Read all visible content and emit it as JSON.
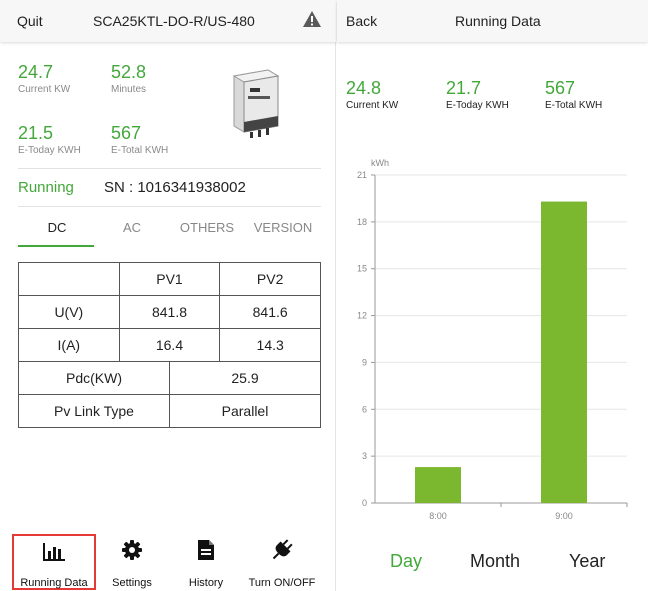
{
  "left": {
    "header": {
      "quit_label": "Quit",
      "model": "SCA25KTL-DO-R/US-480",
      "warning_icon": "warning-icon"
    },
    "stats": [
      {
        "value": "24.7",
        "label": "Current KW"
      },
      {
        "value": "52.8",
        "label": "Minutes"
      },
      {
        "value": "21.5",
        "label": "E-Today KWH"
      },
      {
        "value": "567",
        "label": "E-Total KWH"
      }
    ],
    "status": "Running",
    "sn": "SN : 1016341938002",
    "tabs": [
      "DC",
      "AC",
      "OTHERS",
      "VERSION"
    ],
    "active_tab": "DC",
    "table": {
      "head": [
        "",
        "PV1",
        "PV2"
      ],
      "rows": [
        [
          "U(V)",
          "841.8",
          "841.6"
        ],
        [
          "I(A)",
          "16.4",
          "14.3"
        ]
      ],
      "pdc": [
        "Pdc(KW)",
        "25.9"
      ],
      "link": [
        "Pv Link Type",
        "Parallel"
      ]
    },
    "nav": [
      {
        "label": "Running Data",
        "icon": "bar-chart-icon"
      },
      {
        "label": "Settings",
        "icon": "gear-icon"
      },
      {
        "label": "History",
        "icon": "document-icon"
      },
      {
        "label": "Turn ON/OFF",
        "icon": "plug-icon"
      }
    ]
  },
  "right": {
    "header": {
      "back_label": "Back",
      "title": "Running Data"
    },
    "stats": [
      {
        "value": "24.8",
        "label": "Current KW"
      },
      {
        "value": "21.7",
        "label": "E-Today KWH"
      },
      {
        "value": "567",
        "label": "E-Total KWH"
      }
    ],
    "periods": [
      "Day",
      "Month",
      "Year"
    ],
    "active_period": "Day"
  },
  "colors": {
    "accent": "#43a83a",
    "bar": "#7cb82f",
    "highlight": "#e53935"
  },
  "chart_data": {
    "type": "bar",
    "categories": [
      "8:00",
      "9:00"
    ],
    "values": [
      2.3,
      19.3
    ],
    "ylabel": "kWh",
    "ylim": [
      0,
      21
    ],
    "yticks": [
      0,
      3,
      6,
      9,
      12,
      15,
      18,
      21
    ],
    "grid": true
  }
}
